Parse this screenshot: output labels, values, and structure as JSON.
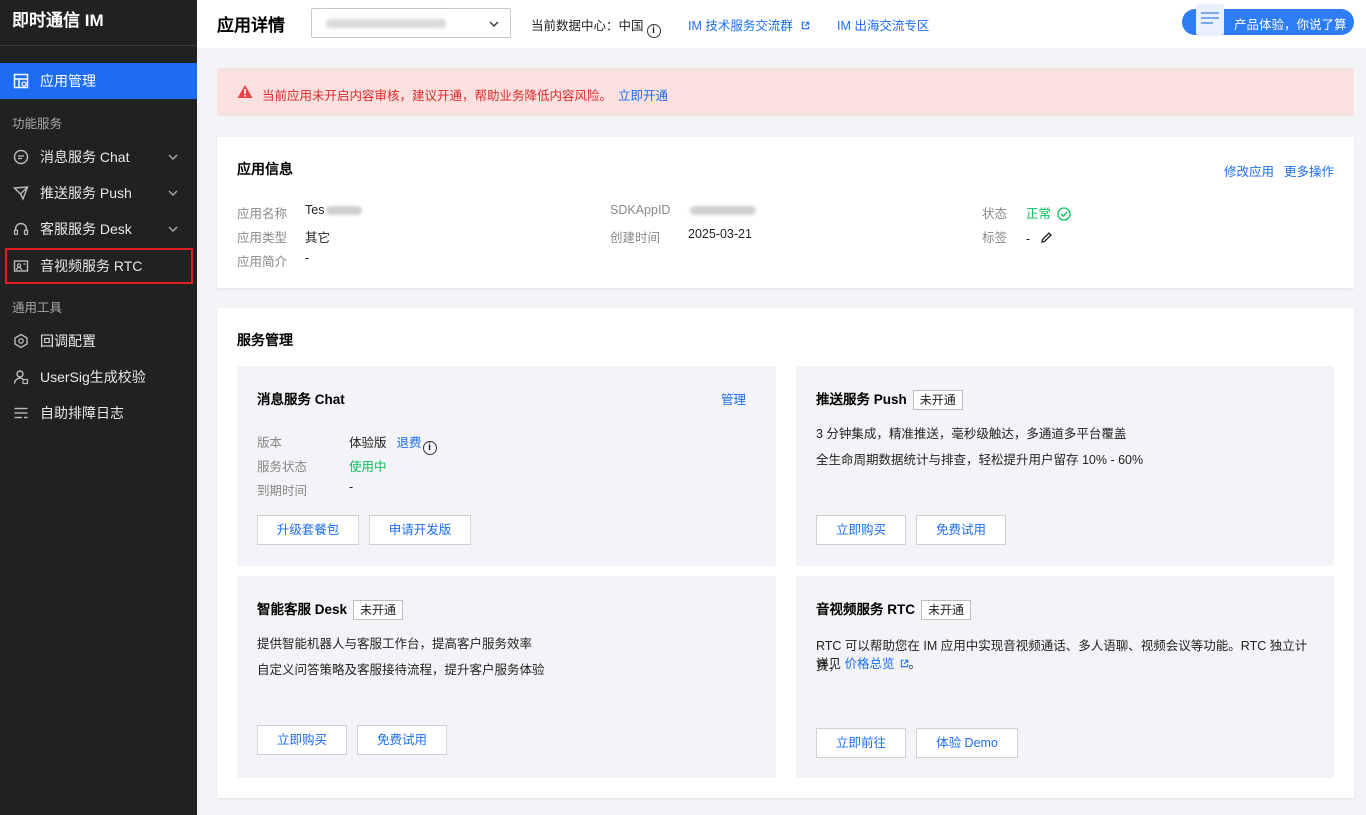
{
  "sidebar": {
    "brand": "即时通信 IM",
    "items": [
      {
        "label": "应用管理",
        "icon": "app-manage-icon"
      },
      {
        "label": "消息服务 Chat",
        "icon": "chat-icon"
      },
      {
        "label": "推送服务 Push",
        "icon": "push-icon"
      },
      {
        "label": "客服服务 Desk",
        "icon": "headset-icon"
      },
      {
        "label": "音视频服务 RTC",
        "icon": "video-icon"
      },
      {
        "label": "回调配置",
        "icon": "callback-icon"
      },
      {
        "label": "UserSig生成校验",
        "icon": "user-sig-icon"
      },
      {
        "label": "自助排障日志",
        "icon": "log-icon"
      }
    ],
    "sections": {
      "services": "功能服务",
      "tools": "通用工具"
    }
  },
  "header": {
    "title": "应用详情",
    "datacenter_label": "当前数据中心：中国",
    "link_tech_group": "IM 技术服务交流群",
    "link_overseas": "IM 出海交流专区",
    "experience_button": "产品体验，你说了算"
  },
  "alert": {
    "text": "当前应用未开启内容审核，建议开通，帮助业务降低内容风险。",
    "link": "立即开通"
  },
  "app_info": {
    "title": "应用信息",
    "action_modify": "修改应用",
    "action_more": "更多操作",
    "fields": {
      "name_label": "应用名称",
      "name_value": "Tes",
      "type_label": "应用类型",
      "type_value": "其它",
      "intro_label": "应用简介",
      "intro_value": "-",
      "sdkappid_label": "SDKAppID",
      "created_label": "创建时间",
      "created_value": "2025-03-21",
      "status_label": "状态",
      "status_value": "正常",
      "tags_label": "标签",
      "tags_value": "-"
    }
  },
  "service_mgmt": {
    "title": "服务管理",
    "chat": {
      "title": "消息服务 Chat",
      "manage": "管理",
      "version_label": "版本",
      "version_value": "体验版",
      "refund": "退费",
      "status_label": "服务状态",
      "status_value": "使用中",
      "expire_label": "到期时间",
      "expire_value": "-",
      "btn_upgrade": "升级套餐包",
      "btn_apply_dev": "申请开发版"
    },
    "push": {
      "title": "推送服务 Push",
      "tag": "未开通",
      "desc1": "3 分钟集成，精准推送，毫秒级触达，多通道多平台覆盖",
      "desc2": "全生命周期数据统计与排查，轻松提升用户留存 10% - 60%",
      "btn_buy": "立即购买",
      "btn_trial": "免费试用"
    },
    "desk": {
      "title": "智能客服 Desk",
      "tag": "未开通",
      "desc1": "提供智能机器人与客服工作台，提高客户服务效率",
      "desc2": "自定义问答策略及客服接待流程，提升客户服务体验",
      "btn_buy": "立即购买",
      "btn_trial": "免费试用"
    },
    "rtc": {
      "title": "音视频服务 RTC",
      "tag": "未开通",
      "desc1": "RTC 可以帮助您在 IM 应用中实现音视频通话、多人语聊、视频会议等功能。RTC 独立计费，",
      "desc2_prefix": "详见",
      "desc2_link": "价格总览",
      "desc2_suffix": "。",
      "btn_go": "立即前往",
      "btn_demo": "体验 Demo"
    }
  },
  "colors": {
    "accent": "#1c6df2",
    "sidebar_bg": "#212121",
    "success": "#0abf5b",
    "alert_bg": "#fbe0e0",
    "alert_text": "#d92a2a"
  }
}
